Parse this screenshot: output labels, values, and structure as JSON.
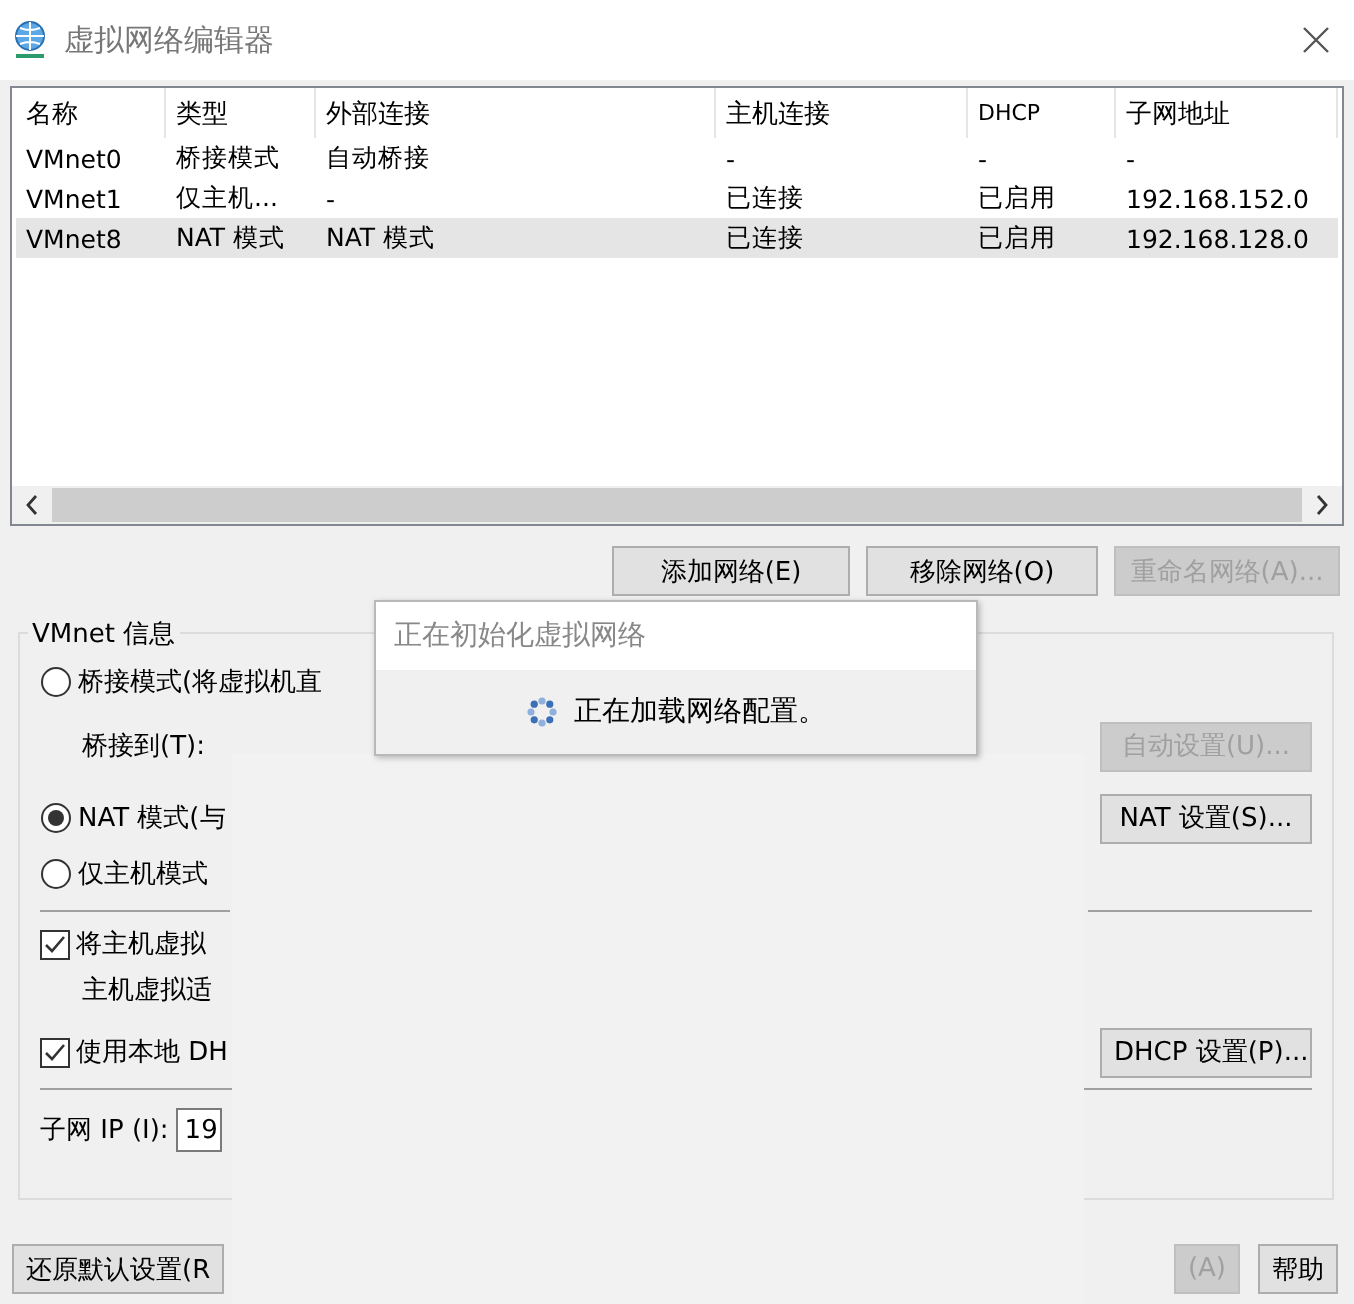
{
  "window": {
    "title": "虚拟网络编辑器"
  },
  "table": {
    "columns": [
      "名称",
      "类型",
      "外部连接",
      "主机连接",
      "DHCP",
      "子网地址"
    ],
    "rows": [
      {
        "cells": [
          "VMnet0",
          "桥接模式",
          "自动桥接",
          "-",
          "-",
          "-"
        ],
        "selected": false
      },
      {
        "cells": [
          "VMnet1",
          "仅主机...",
          "-",
          "已连接",
          "已启用",
          "192.168.152.0"
        ],
        "selected": false
      },
      {
        "cells": [
          "VMnet8",
          "NAT 模式",
          "NAT 模式",
          "已连接",
          "已启用",
          "192.168.128.0"
        ],
        "selected": true
      }
    ]
  },
  "list_buttons": [
    {
      "label": "添加网络(E)",
      "disabled": false
    },
    {
      "label": "移除网络(O)",
      "disabled": false
    },
    {
      "label": "重命名网络(A)...",
      "disabled": true
    }
  ],
  "vmnet_info": {
    "title": "VMnet 信息",
    "bridged": {
      "label": "桥接模式(将虚拟机直",
      "checked": false
    },
    "bridge_to": {
      "label": "桥接到(T):"
    },
    "auto_button": {
      "label": "自动设置(U)...",
      "disabled": true
    },
    "nat": {
      "label": "NAT 模式(与",
      "checked": true
    },
    "nat_button": {
      "label": "NAT 设置(S)...",
      "disabled": false
    },
    "host_only": {
      "label": "仅主机模式",
      "checked": false
    },
    "connect_adapter": {
      "label": "将主机虚拟",
      "note": "主机虚拟适",
      "checked": true
    },
    "dhcp": {
      "label": "使用本地 DH",
      "checked": true
    },
    "dhcp_button": {
      "label": "DHCP 设置(P)...",
      "disabled": false
    },
    "subnet_ip": {
      "label": "子网 IP (I):",
      "value": "19"
    }
  },
  "bottom_buttons": [
    {
      "label": "还原默认设置(R",
      "disabled": false
    },
    {
      "label": "(A)",
      "disabled": true
    },
    {
      "label": "帮助",
      "disabled": false
    }
  ],
  "popup": {
    "title": "正在初始化虚拟网络",
    "message": "正在加载网络配置。"
  }
}
